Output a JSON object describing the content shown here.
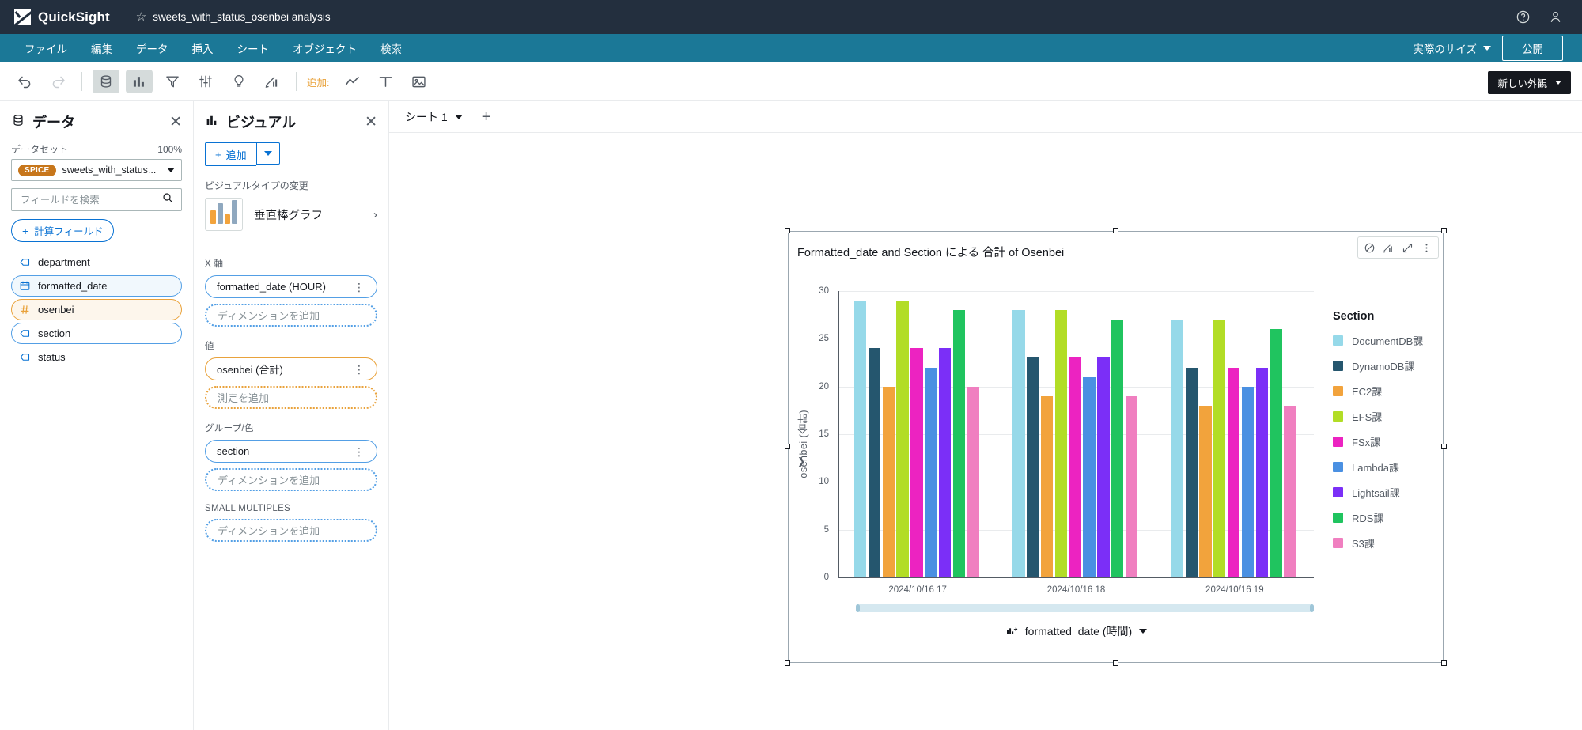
{
  "topbar": {
    "product": "QuickSight",
    "logo_icon": "quicksight-logo",
    "star_icon": "star-outline-icon",
    "document_title": "sweets_with_status_osenbei analysis",
    "help_icon": "help-circle-icon",
    "account_icon": "user-account-icon"
  },
  "menubar": {
    "items": [
      {
        "label": "ファイル",
        "name": "menu-file"
      },
      {
        "label": "編集",
        "name": "menu-edit"
      },
      {
        "label": "データ",
        "name": "menu-data"
      },
      {
        "label": "挿入",
        "name": "menu-insert"
      },
      {
        "label": "シート",
        "name": "menu-sheet"
      },
      {
        "label": "オブジェクト",
        "name": "menu-object"
      },
      {
        "label": "検索",
        "name": "menu-search"
      }
    ],
    "size_selector": "実際のサイズ",
    "publish": "公開"
  },
  "toolbar": {
    "undo_icon": "undo-icon",
    "redo_icon": "redo-icon",
    "data_icon": "database-icon",
    "visualize_icon": "bar-chart-icon",
    "filter_icon": "filter-icon",
    "parameters_icon": "sliders-icon",
    "insights_icon": "lightbulb-icon",
    "themes_icon": "theme-paint-icon",
    "add_label": "追加:",
    "add_line_icon": "line-chart-icon",
    "add_text_icon": "text-box-icon",
    "add_image_icon": "image-icon",
    "new_look": "新しい外観"
  },
  "data_panel": {
    "title": "データ",
    "title_icon": "database-icon",
    "close_icon": "close-icon",
    "dataset_label": "データセット",
    "percent": "100%",
    "dataset_badge": "SPICE",
    "dataset_name": "sweets_with_status...",
    "search_placeholder": "フィールドを検索",
    "search_icon": "search-icon",
    "calculated_field": "計算フィールド",
    "fields": [
      {
        "label": "department",
        "type": "dimension",
        "state": "plain"
      },
      {
        "label": "formatted_date",
        "type": "date",
        "state": "selected-blue"
      },
      {
        "label": "osenbei",
        "type": "measure",
        "state": "selected-orange"
      },
      {
        "label": "section",
        "type": "dimension",
        "state": "outline-blue"
      },
      {
        "label": "status",
        "type": "dimension",
        "state": "plain"
      }
    ]
  },
  "visual_panel": {
    "title": "ビジュアル",
    "title_icon": "bar-chart-icon",
    "close_icon": "close-icon",
    "add_label": "追加",
    "change_type_label": "ビジュアルタイプの変更",
    "visual_type": "垂直棒グラフ",
    "wells": [
      {
        "label": "X 軸",
        "name": "x-axis",
        "pill": "formatted_date (HOUR)",
        "pill_style": "blue",
        "placeholder": "ディメンションを追加",
        "placeholder_style": "blue"
      },
      {
        "label": "値",
        "name": "value",
        "pill": "osenbei (合計)",
        "pill_style": "orange",
        "placeholder": "測定を追加",
        "placeholder_style": "orange"
      },
      {
        "label": "グループ/色",
        "name": "group-color",
        "pill": "section",
        "pill_style": "blue",
        "placeholder": "ディメンションを追加",
        "placeholder_style": "blue"
      },
      {
        "label": "SMALL MULTIPLES",
        "name": "small-multiples",
        "pill": null,
        "pill_style": null,
        "placeholder": "ディメンションを追加",
        "placeholder_style": "blue"
      }
    ]
  },
  "sheet": {
    "tab_label": "シート 1",
    "tab_caret_icon": "chevron-down-icon",
    "add_sheet_icon": "plus-icon"
  },
  "visual": {
    "title": "Formatted_date and Section による 合計 of Osenbei",
    "actions": [
      {
        "name": "filter-action-icon",
        "glyph": "⊘"
      },
      {
        "name": "insights-action-icon",
        "glyph": "◬"
      },
      {
        "name": "maximize-action-icon",
        "glyph": "⤢"
      },
      {
        "name": "menu-action-icon",
        "glyph": "⋮"
      }
    ],
    "x_axis_footer": "formatted_date (時間)",
    "x_axis_footer_icon": "axis-field-icon",
    "x_axis_footer_caret": "chevron-down-icon"
  },
  "chart_data": {
    "type": "bar",
    "title": "Formatted_date and Section による 合計 of Osenbei",
    "xlabel": "formatted_date (時間)",
    "ylabel": "osenbei (合計)",
    "ylim": [
      0,
      30
    ],
    "yticks": [
      0,
      5,
      10,
      15,
      20,
      25,
      30
    ],
    "grid": true,
    "legend_title": "Section",
    "legend_position": "right",
    "categories": [
      "2024/10/16 17",
      "2024/10/16 18",
      "2024/10/16 19"
    ],
    "series": [
      {
        "name": "DocumentDB課",
        "color": "#96d9e9",
        "values": [
          29,
          28,
          27
        ]
      },
      {
        "name": "DynamoDB課",
        "color": "#25566e",
        "values": [
          24,
          23,
          22
        ]
      },
      {
        "name": "EC2課",
        "color": "#f2a33c",
        "values": [
          20,
          19,
          18
        ]
      },
      {
        "name": "EFS課",
        "color": "#b2dd26",
        "values": [
          29,
          28,
          27
        ]
      },
      {
        "name": "FSx課",
        "color": "#ec23c1",
        "values": [
          24,
          23,
          22
        ]
      },
      {
        "name": "Lambda課",
        "color": "#4a90e2",
        "values": [
          22,
          21,
          20
        ]
      },
      {
        "name": "Lightsail課",
        "color": "#7b2ff7",
        "values": [
          24,
          23,
          22
        ]
      },
      {
        "name": "RDS課",
        "color": "#20c45f",
        "values": [
          28,
          27,
          26
        ]
      },
      {
        "name": "S3課",
        "color": "#f07fc0",
        "values": [
          20,
          19,
          18
        ]
      }
    ]
  }
}
